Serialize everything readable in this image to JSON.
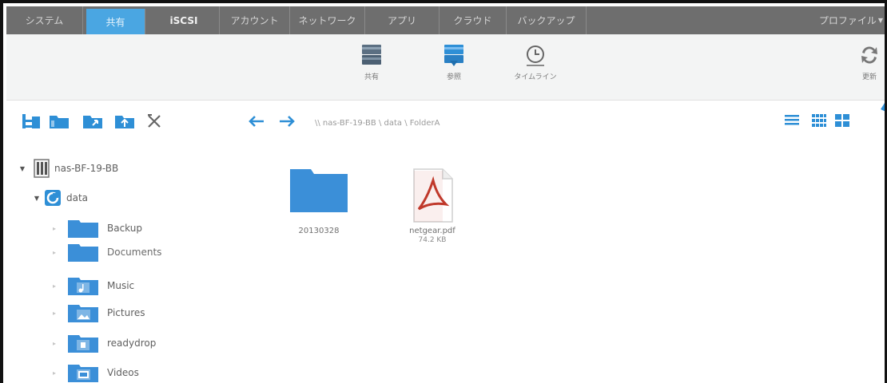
{
  "nav": {
    "tabs": [
      {
        "label": "システム"
      },
      {
        "label": "共有"
      },
      {
        "label": "iSCSI"
      },
      {
        "label": "アカウント"
      },
      {
        "label": "ネットワーク"
      },
      {
        "label": "アプリ"
      },
      {
        "label": "クラウド"
      },
      {
        "label": "バックアップ"
      }
    ],
    "profile_label": "プロファイル",
    "active_tab": "共有"
  },
  "toolbar": {
    "buttons": [
      {
        "label": "共有",
        "icon": "shares-icon"
      },
      {
        "label": "参照",
        "icon": "browse-icon"
      },
      {
        "label": "タイムライン",
        "icon": "timeline-icon"
      },
      {
        "label": "更新",
        "icon": "refresh-icon"
      }
    ]
  },
  "pathbar": {
    "address": "\\\\ nas-BF-19-BB \\ data \\ FolderA",
    "left_icons": [
      "tree-toggle-icon",
      "folder-icon",
      "folder-move-icon",
      "folder-upload-icon",
      "close-icon"
    ],
    "view_icons": [
      "list-view-icon",
      "small-grid-view-icon",
      "large-grid-view-icon"
    ]
  },
  "tree": {
    "root": {
      "label": "nas-BF-19-BB"
    },
    "volume": {
      "label": "data"
    },
    "folders": [
      {
        "label": "Backup"
      },
      {
        "label": "Documents",
        "selected": true
      },
      {
        "label": "Music"
      },
      {
        "label": "Pictures"
      },
      {
        "label": "readydrop"
      },
      {
        "label": "Videos"
      }
    ]
  },
  "content": {
    "items": [
      {
        "name": "20130328",
        "type": "folder"
      },
      {
        "name": "netgear.pdf",
        "size": "74.2 KB",
        "type": "pdf"
      }
    ]
  },
  "colors": {
    "nav_bg": "#6e6e6e",
    "nav_active": "#4aa6e2",
    "toolbar_bg": "#f3f4f4",
    "accent_blue": "#3b8fd8",
    "selection": "#fbf5c8"
  }
}
